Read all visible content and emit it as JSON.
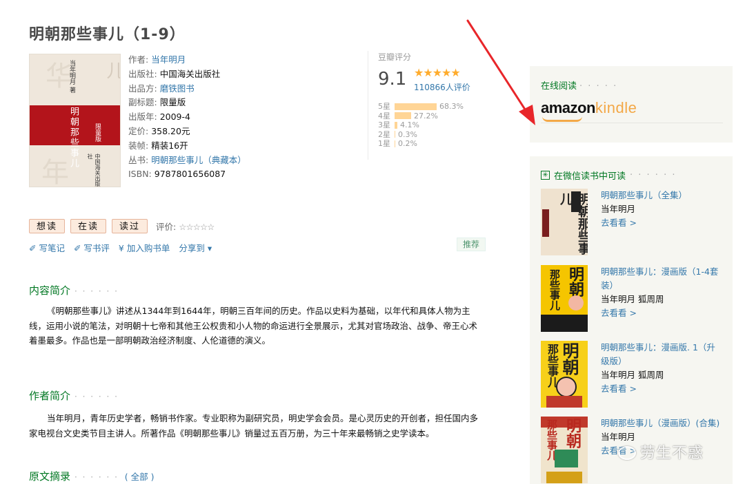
{
  "book": {
    "title": "明朝那些事儿（1-9）",
    "cover_text": {
      "author": "当年明月 著",
      "title": "明朝那些事儿",
      "edition": "限量版",
      "publisher": "中国海关出版社"
    },
    "info": [
      {
        "label": "作者:",
        "value": "当年明月",
        "link": true
      },
      {
        "label": "出版社:",
        "value": "中国海关出版社",
        "link": false
      },
      {
        "label": "出品方:",
        "value": "磨铁图书",
        "link": true
      },
      {
        "label": "副标题:",
        "value": "限量版",
        "link": false
      },
      {
        "label": "出版年:",
        "value": "2009-4",
        "link": false
      },
      {
        "label": "定价:",
        "value": "358.20元",
        "link": false
      },
      {
        "label": "装帧:",
        "value": "精装16开",
        "link": false
      },
      {
        "label": "丛书:",
        "value": "明朝那些事儿（典藏本）",
        "link": true
      },
      {
        "label": "ISBN:",
        "value": "9787801656087",
        "link": false
      }
    ]
  },
  "rating": {
    "caption": "豆瓣评分",
    "score": "9.1",
    "stars": "★★★★★",
    "count": "110866人评价",
    "distribution": [
      {
        "label": "5星",
        "percent": "68.3%",
        "value": 68.3
      },
      {
        "label": "4星",
        "percent": "27.2%",
        "value": 27.2
      },
      {
        "label": "3星",
        "percent": "4.1%",
        "value": 4.1
      },
      {
        "label": "2星",
        "percent": "0.3%",
        "value": 0.3
      },
      {
        "label": "1星",
        "percent": "0.2%",
        "value": 0.2
      }
    ]
  },
  "status_buttons": [
    "想读",
    "在读",
    "读过"
  ],
  "evaluate": {
    "label": "评价:",
    "stars": "☆☆☆☆☆"
  },
  "actions": [
    "✐ 写笔记",
    "✐ 写书评",
    "¥ 加入购书单",
    "分享到 ▾"
  ],
  "recommend_label": "推荐",
  "sections": {
    "intro": {
      "heading": "内容简介",
      "dots": "· · · · · ·",
      "text": "《明朝那些事儿》讲述从1344年到1644年，明朝三百年间的历史。作品以史料为基础，以年代和具体人物为主线，运用小说的笔法，对明朝十七帝和其他王公权贵和小人物的命运进行全景展示，尤其对官场政治、战争、帝王心术着墨最多。作品也是一部明朝政治经济制度、人伦道德的演义。"
    },
    "author": {
      "heading": "作者简介",
      "dots": "· · · · · ·",
      "text": "当年明月，青年历史学者，畅销书作家。专业职称为副研究员，明史学会会员。是心灵历史的开创者，担任国内多家电视台文史类节目主讲人。所著作品《明朝那些事儿》销量过五百万册，为三十年来最畅销之史学读本。"
    },
    "excerpt": {
      "heading": "原文摘录",
      "dots": "· · · · · ·",
      "link": "( 全部 )"
    }
  },
  "sidebar": {
    "online_read": {
      "heading": "在线阅读",
      "dots": "· · · · ·",
      "brand_main": "amazon",
      "brand_sub": "kindle"
    },
    "weread": {
      "heading": "在微信读书中可读",
      "dots": "· · · · · ·",
      "items": [
        {
          "title": "明朝那些事儿（全集）",
          "author": "当年明月",
          "link": "去看看 >"
        },
        {
          "title": "明朝那些事儿：漫画版（1-4套装）",
          "author": "当年明月 狐周周",
          "link": "去看看 >"
        },
        {
          "title": "明朝那些事儿：漫画版. 1（升级版）",
          "author": "当年明月 狐周周",
          "link": "去看看 >"
        },
        {
          "title": "明朝那些事儿（漫画版）(合集)",
          "author": "当年明月",
          "link": "去看看 >"
        }
      ]
    }
  },
  "watermark": "劳生不惑",
  "colors": {
    "link": "#3377aa",
    "green": "#007722",
    "star": "#ffac2d",
    "red_arrow": "#e8262a"
  }
}
